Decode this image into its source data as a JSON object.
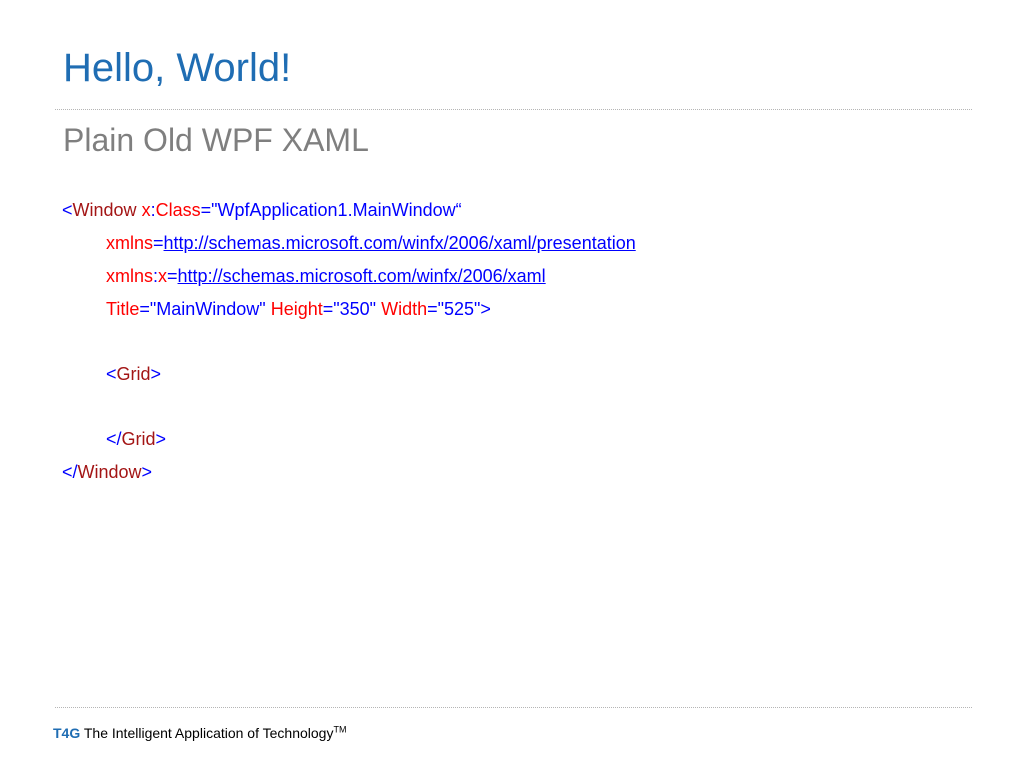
{
  "slide": {
    "title": "Hello, World!",
    "subtitle": "Plain Old WPF XAML"
  },
  "code": {
    "lines": [
      {
        "window_open": "<",
        "window_tag": "Window",
        "sp1": " ",
        "x_prefix": "x",
        "colon1": ":",
        "class_attr": "Class",
        "eq1": "=",
        "class_value": "\"WpfApplication1.MainWindow“"
      },
      {
        "xmlns_attr": "xmlns",
        "eq": "=",
        "url": "http://schemas.microsoft.com/winfx/2006/xaml/presentation"
      },
      {
        "xmlns_attr": "xmlns",
        "colon": ":",
        "x_name": "x",
        "eq": "=",
        "url": "http://schemas.microsoft.com/winfx/2006/xaml"
      },
      {
        "title_attr": "Title",
        "eq1": "=",
        "title_value": "\"MainWindow\"",
        "sp1": " ",
        "height_attr": "Height",
        "eq2": "=",
        "height_value": "\"350\"",
        "sp2": " ",
        "width_attr": "Width",
        "eq3": "=",
        "width_value": "\"525\"",
        "close": ">"
      },
      {
        "open": "<",
        "tag": "Grid",
        "close": ">"
      },
      {
        "open": "</",
        "tag": "Grid",
        "close": ">"
      },
      {
        "open": "</",
        "tag": "Window",
        "close": ">"
      }
    ]
  },
  "footer": {
    "brand": "T4G",
    "tagline": " The Intelligent Application of Technology",
    "trademark": "TM"
  },
  "colors": {
    "title": "#1f6db3",
    "subtitle": "#7f7f7f",
    "xaml_delimiter": "#0000ff",
    "xaml_element": "#a31515",
    "xaml_attribute": "#ff0000",
    "divider": "#b5b5b5"
  }
}
